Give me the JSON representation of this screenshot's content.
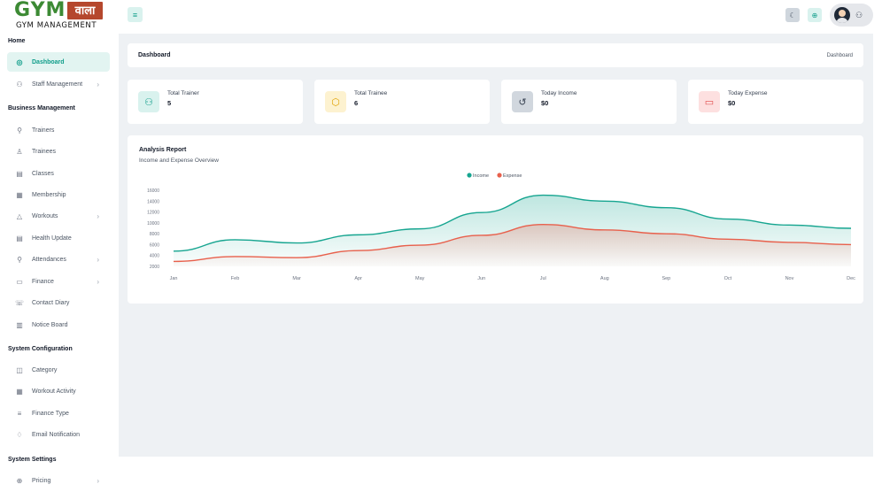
{
  "brand": {
    "logo_main": "GYM",
    "logo_hindi": "वाला",
    "logo_sub": "GYM MANAGEMENT"
  },
  "sidebar": {
    "sections": [
      {
        "title": "Home",
        "items": [
          {
            "label": "Dashboard",
            "icon": "dashboard-icon",
            "active": true,
            "chevron": false
          },
          {
            "label": "Staff Management",
            "icon": "users-icon",
            "active": false,
            "chevron": true
          }
        ]
      },
      {
        "title": "Business Management",
        "items": [
          {
            "label": "Trainers",
            "icon": "user-check-icon",
            "chevron": false
          },
          {
            "label": "Trainees",
            "icon": "user-icon",
            "chevron": false
          },
          {
            "label": "Classes",
            "icon": "calendar-icon",
            "chevron": false
          },
          {
            "label": "Membership",
            "icon": "membership-icon",
            "chevron": false
          },
          {
            "label": "Workouts",
            "icon": "workout-icon",
            "chevron": true
          },
          {
            "label": "Health Update",
            "icon": "health-icon",
            "chevron": false
          },
          {
            "label": "Attendances",
            "icon": "attendance-icon",
            "chevron": true
          },
          {
            "label": "Finance",
            "icon": "finance-icon",
            "chevron": true
          },
          {
            "label": "Contact Diary",
            "icon": "contact-icon",
            "chevron": false
          },
          {
            "label": "Notice Board",
            "icon": "notice-icon",
            "chevron": false
          }
        ]
      },
      {
        "title": "System Configuration",
        "items": [
          {
            "label": "Category",
            "icon": "category-icon",
            "chevron": false
          },
          {
            "label": "Workout Activity",
            "icon": "activity-icon",
            "chevron": false
          },
          {
            "label": "Finance Type",
            "icon": "list-icon",
            "chevron": false
          },
          {
            "label": "Email Notification",
            "icon": "bell-icon",
            "chevron": false
          }
        ]
      },
      {
        "title": "System Settings",
        "items": [
          {
            "label": "Pricing",
            "icon": "pricing-icon",
            "chevron": true
          }
        ]
      }
    ]
  },
  "header": {
    "page_title": "Dashboard",
    "breadcrumb": "Dashboard"
  },
  "stats": [
    {
      "label": "Total Trainer",
      "value": "5",
      "icon": "trainer-group-icon",
      "color": "#0f9d8a",
      "bg": "#d9f2ee"
    },
    {
      "label": "Total Trainee",
      "value": "6",
      "icon": "box-icon",
      "color": "#e0a100",
      "bg": "#fdf2d0"
    },
    {
      "label": "Today Income",
      "value": "$0",
      "icon": "history-icon",
      "color": "#374151",
      "bg": "#d1d7de"
    },
    {
      "label": "Today Expense",
      "value": "$0",
      "icon": "wallet-icon",
      "color": "#e24c4c",
      "bg": "#fde0e0"
    }
  ],
  "chart_data": {
    "type": "area",
    "title": "Analysis Report",
    "subtitle": "Income and Expense Overview",
    "categories": [
      "Jan",
      "Feb",
      "Mar",
      "Apr",
      "May",
      "Jun",
      "Jul",
      "Aug",
      "Sep",
      "Oct",
      "Nov",
      "Dec"
    ],
    "y_ticks": [
      "16000",
      "14000",
      "12000",
      "10000",
      "8000",
      "6000",
      "4000",
      "2000"
    ],
    "ylim": [
      2000,
      16000
    ],
    "series": [
      {
        "name": "Income",
        "color": "#16a590",
        "values": [
          4800,
          6900,
          6300,
          7800,
          8900,
          11900,
          15100,
          14000,
          12800,
          10700,
          9600,
          9000
        ]
      },
      {
        "name": "Expense",
        "color": "#e8604c",
        "values": [
          2900,
          3800,
          3600,
          4900,
          5900,
          7700,
          9700,
          8700,
          8000,
          7000,
          6400,
          6000
        ]
      }
    ],
    "legend_position": "top-center",
    "grid": false
  }
}
